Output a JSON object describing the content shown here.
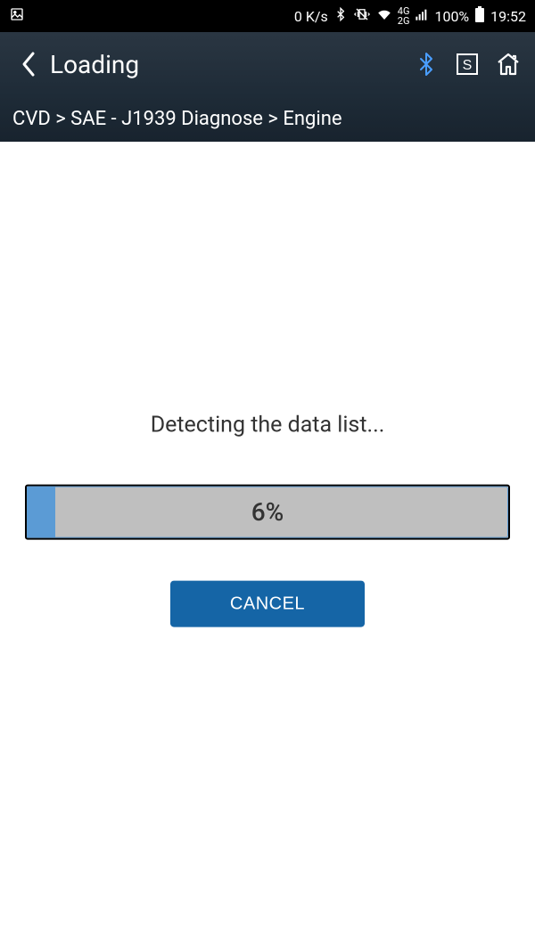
{
  "status_bar": {
    "data_rate": "0 K/s",
    "network_top": "4G",
    "network_bottom": "2G",
    "battery_pct": "100%",
    "time": "19:52"
  },
  "header": {
    "title": "Loading"
  },
  "breadcrumb": "CVD > SAE - J1939 Diagnose > Engine",
  "loading": {
    "message": "Detecting the data list...",
    "percent_text": "6%",
    "percent_value": 6,
    "cancel_label": "CANCEL"
  }
}
